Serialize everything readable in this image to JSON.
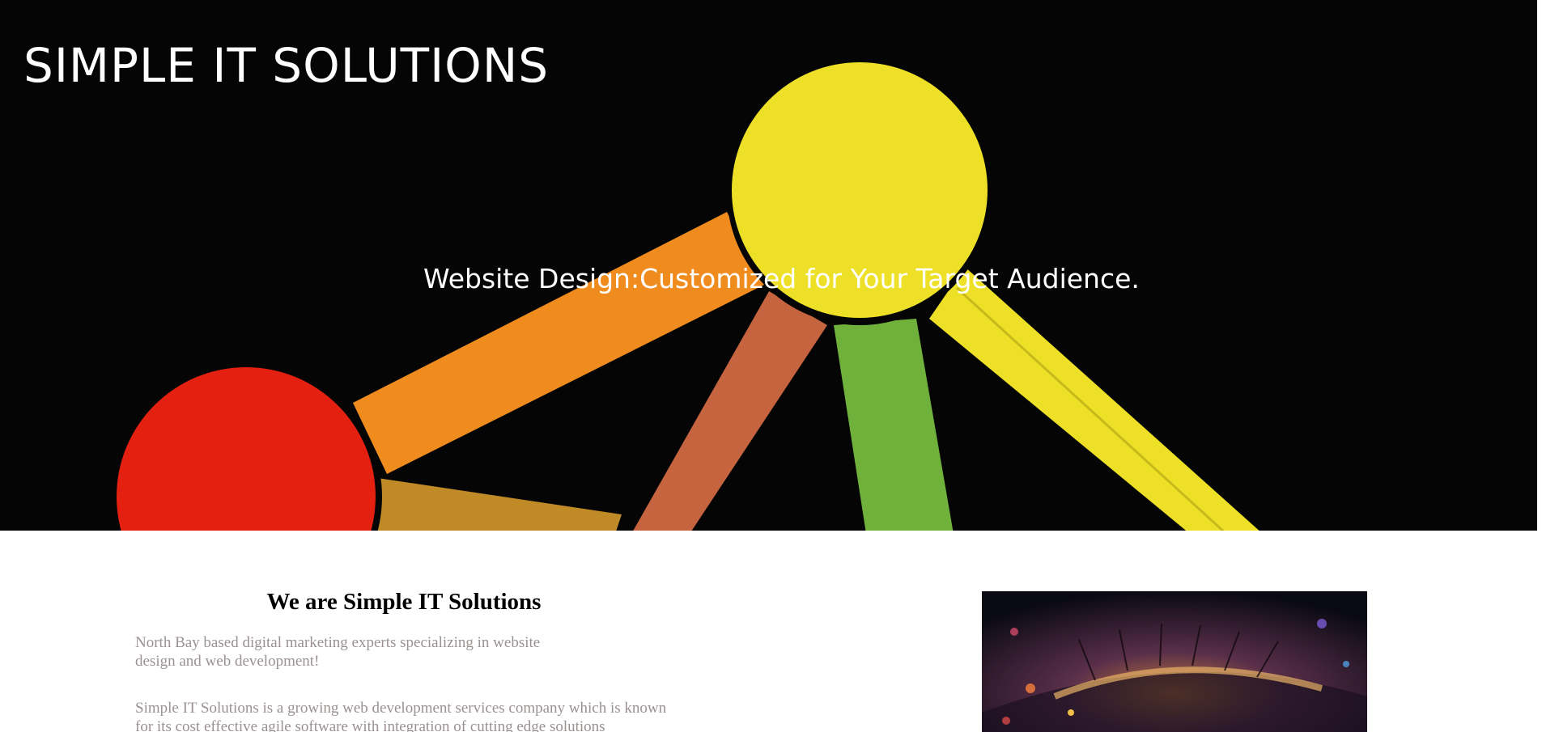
{
  "hero": {
    "site_title": "SIMPLE IT SOLUTIONS",
    "tagline": "Website Design:Customized for Your Target Audience."
  },
  "about": {
    "heading": "We are Simple IT Solutions",
    "intro": "North Bay based digital marketing experts specializing in website design and web development!",
    "body": "Simple IT Solutions is a growing web development services company which is known for its cost effective agile software with integration of cutting edge solutions"
  },
  "colors": {
    "hero_bg": "#050505",
    "yellow": "#ede026",
    "red": "#e42010",
    "orange": "#f08c1e",
    "green": "#6fb13a",
    "body_text": "#9a9191"
  }
}
